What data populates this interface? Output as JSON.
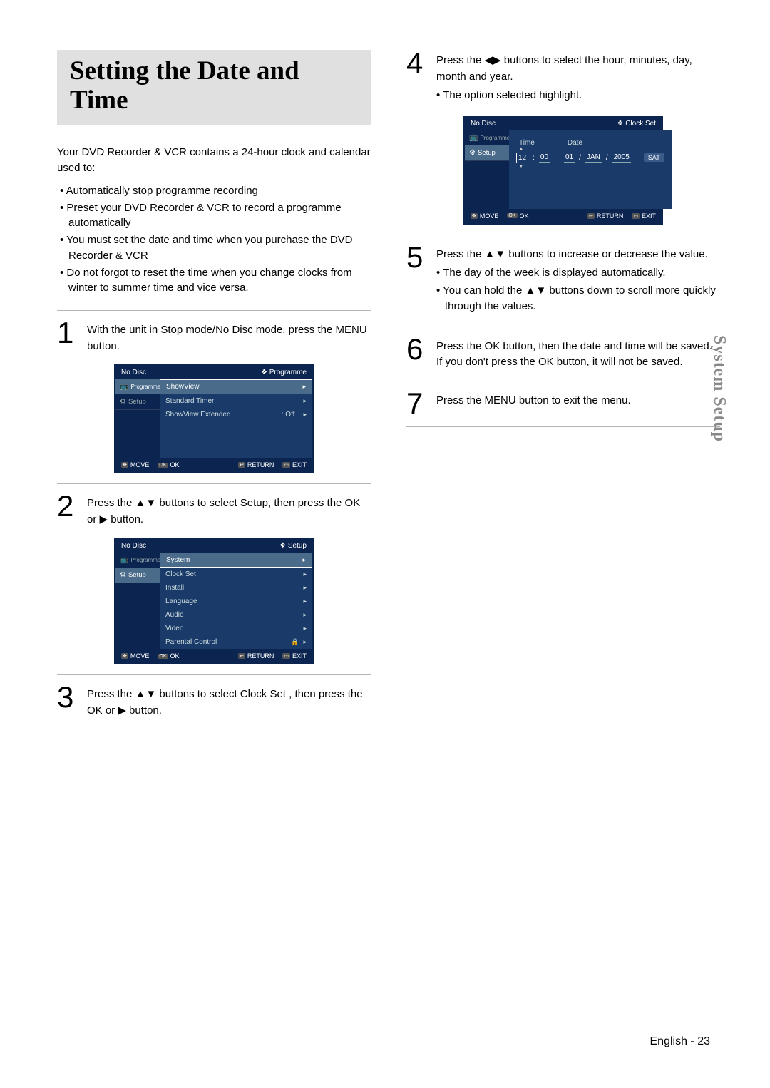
{
  "title": "Setting the Date and Time",
  "intro": "Your DVD Recorder & VCR contains a 24-hour clock and calendar used to:",
  "intro_bullets": [
    "Automatically stop programme recording",
    "Preset your DVD Recorder & VCR to record a programme automatically",
    "You must set the date and time when you purchase the DVD Recorder & VCR",
    "Do not forgot to reset the time when you change clocks from winter to summer time and vice versa."
  ],
  "steps": {
    "s1": "With the unit in Stop mode/No Disc mode, press the MENU button.",
    "s2": "Press the ▲▼ buttons to select Setup, then press the OK or ▶ button.",
    "s3": "Press the ▲▼ buttons to select Clock Set , then press the OK or ▶ button.",
    "s4": "Press the ◀▶ buttons to select the hour, minutes, day, month and year.",
    "s4_bullets": [
      "The option selected highlight."
    ],
    "s5": "Press the ▲▼ buttons to increase or decrease the value.",
    "s5_bullets": [
      "The day of the week is displayed automatically.",
      "You can hold the ▲▼ buttons down to scroll more quickly through the values."
    ],
    "s6": "Press the OK button, then the date and time will be saved. If you don't press the OK button, it will not be saved.",
    "s7": "Press the MENU button to exit the menu."
  },
  "numbers": {
    "n1": "1",
    "n2": "2",
    "n3": "3",
    "n4": "4",
    "n5": "5",
    "n6": "6",
    "n7": "7"
  },
  "osd": {
    "nodisc": "No Disc",
    "diamond": "❖",
    "programme": "Programme",
    "setup": "Setup",
    "showview": "ShowView",
    "standard_timer": "Standard Timer",
    "showview_ext": "ShowView Extended",
    "off": ": Off",
    "system": "System",
    "clockset": "Clock Set",
    "install": "Install",
    "language": "Language",
    "audio": "Audio",
    "video": "Video",
    "parental": "Parental Control",
    "time_label": "Time",
    "date_label": "Date",
    "hour": "12",
    "colon": ":",
    "min": "00",
    "day": "01",
    "slash": "/",
    "mon": "JAN",
    "year": "2005",
    "sat": "SAT",
    "footer": {
      "move": "MOVE",
      "ok": "OK",
      "return": "RETURN",
      "exit": "EXIT"
    }
  },
  "side_tab": "System Setup",
  "footer": "English - 23"
}
